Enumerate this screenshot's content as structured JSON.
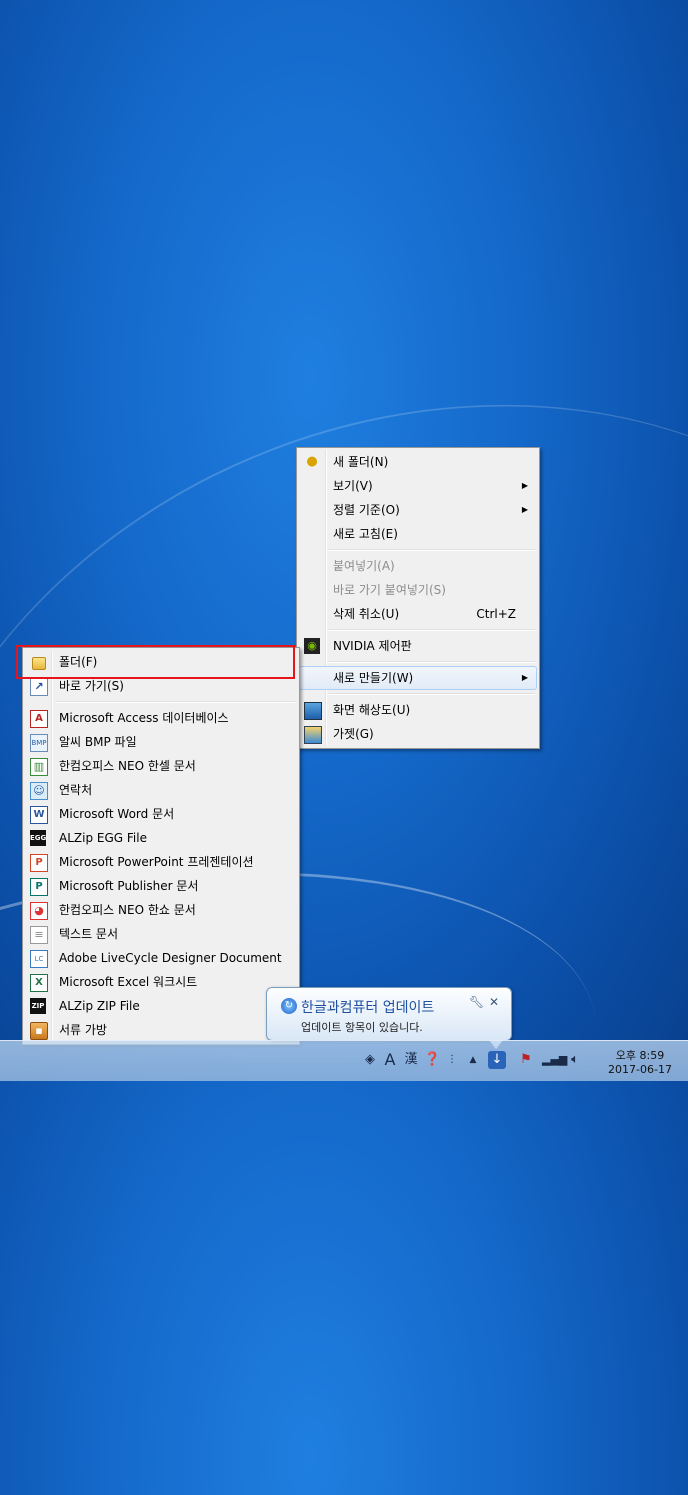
{
  "desktop_menu": {
    "items": [
      {
        "label": "새 폴더(N)",
        "icon": "new-folder-icon"
      },
      {
        "label": "보기(V)",
        "submenu": true
      },
      {
        "label": "정렬 기준(O)",
        "submenu": true
      },
      {
        "label": "새로 고침(E)"
      },
      {
        "label": "붙여넣기(A)",
        "disabled": true
      },
      {
        "label": "바로 가기 붙여넣기(S)",
        "disabled": true
      },
      {
        "label": "삭제 취소(U)",
        "shortcut": "Ctrl+Z"
      },
      {
        "label": "NVIDIA 제어판",
        "icon": "nvidia-icon"
      },
      {
        "label": "새로 만들기(W)",
        "submenu": true,
        "highlighted": true
      },
      {
        "label": "화면 해상도(U)",
        "icon": "display-icon"
      },
      {
        "label": "가젯(G)",
        "icon": "gadget-icon"
      }
    ]
  },
  "new_submenu": {
    "items": [
      {
        "label": "폴더(F)",
        "icon": "folder-icon"
      },
      {
        "label": "바로 가기(S)",
        "icon": "shortcut-icon"
      },
      {
        "label": "Microsoft Access 데이터베이스",
        "icon": "access-icon"
      },
      {
        "label": "알씨 BMP 파일",
        "icon": "bmp-icon"
      },
      {
        "label": "한컴오피스 NEO 한셀 문서",
        "icon": "hancell-icon"
      },
      {
        "label": "연락처",
        "icon": "contact-icon"
      },
      {
        "label": "Microsoft Word 문서",
        "icon": "word-icon"
      },
      {
        "label": "ALZip EGG File",
        "icon": "egg-icon"
      },
      {
        "label": "Microsoft PowerPoint 프레젠테이션",
        "icon": "powerpoint-icon"
      },
      {
        "label": "Microsoft Publisher 문서",
        "icon": "publisher-icon"
      },
      {
        "label": "한컴오피스 NEO 한쇼 문서",
        "icon": "hanshow-icon"
      },
      {
        "label": "텍스트 문서",
        "icon": "text-document-icon"
      },
      {
        "label": "Adobe LiveCycle Designer Document",
        "icon": "livecycle-icon"
      },
      {
        "label": "Microsoft Excel 워크시트",
        "icon": "excel-icon"
      },
      {
        "label": "ALZip ZIP File",
        "icon": "zip-icon"
      },
      {
        "label": "서류 가방",
        "icon": "briefcase-icon"
      }
    ]
  },
  "balloon": {
    "title": "한글과컴퓨터 업데이트",
    "text": "업데이트 항목이 있습니다."
  },
  "tray": {
    "ime_label": "A",
    "hanja_label": "漢",
    "time": "오후 8:59",
    "date": "2017-06-17"
  },
  "colors": {
    "highlight_box": "#e8141c",
    "desktop_blue": "#1468c9"
  }
}
